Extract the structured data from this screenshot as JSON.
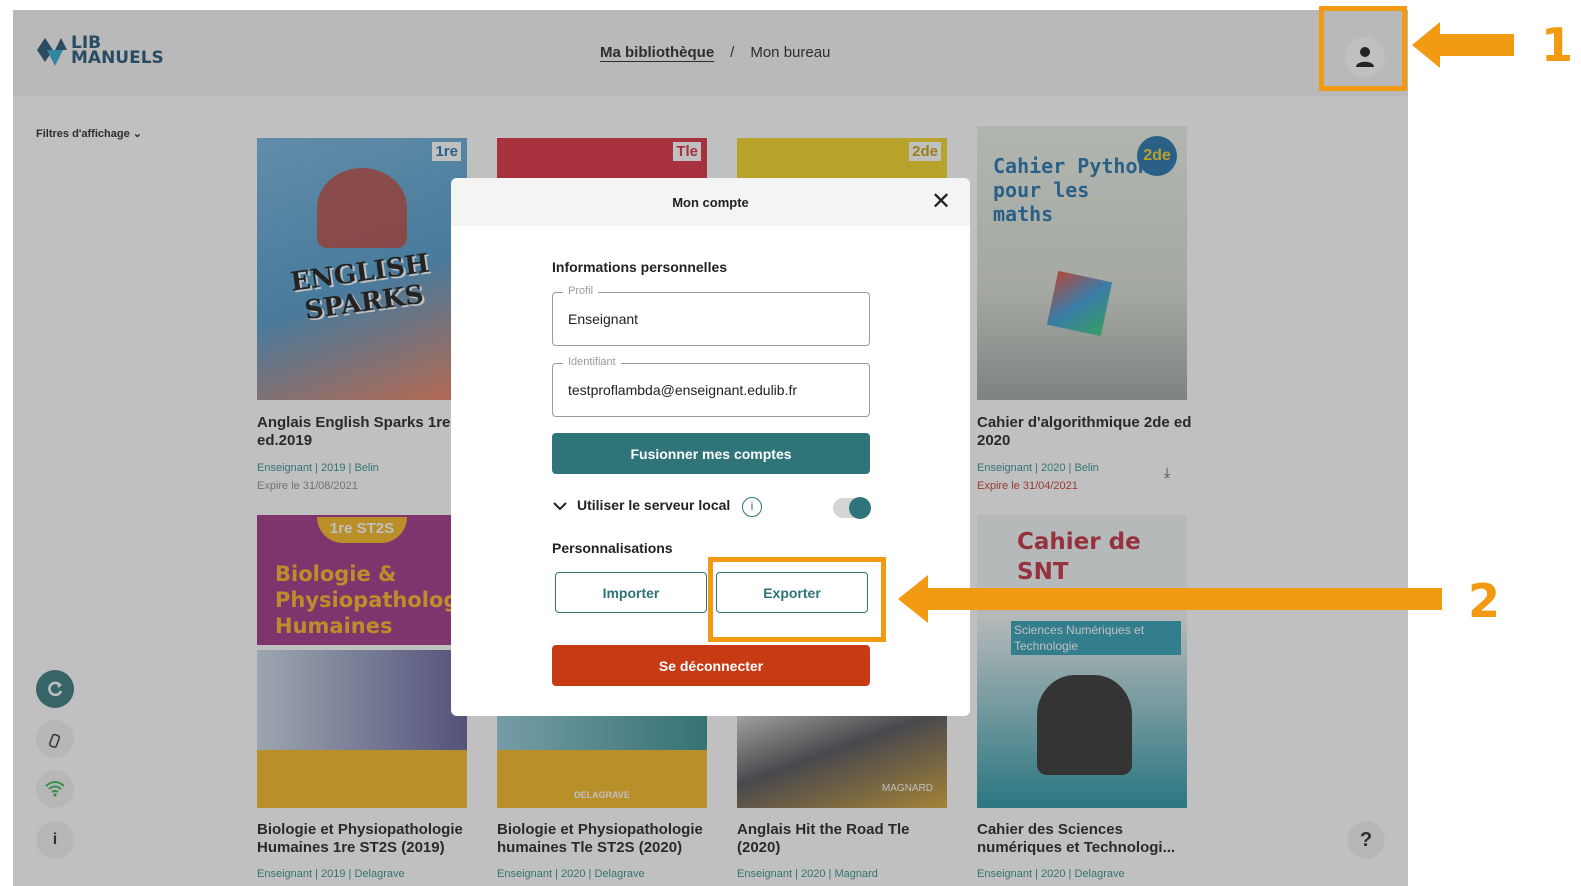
{
  "app": {
    "logo": {
      "line1": "LIB",
      "line2": "MANUELS"
    },
    "breadcrumb": {
      "current": "Ma bibliothèque",
      "separator": "/",
      "next": "Mon bureau"
    }
  },
  "filters": {
    "label": "Filtres d'affichage",
    "chevron": "⌄"
  },
  "books": [
    {
      "title": "Anglais English Sparks 1re ed.2019",
      "meta": "Enseignant | 2019 | Belin",
      "expiry": "Expire le 31/08/2021",
      "cover_text": "ENGLISH SPARKS",
      "badge": "1re"
    },
    {
      "title": "",
      "meta": "",
      "expiry": "",
      "cover_text": "",
      "badge": "Tle"
    },
    {
      "title": "",
      "meta": "",
      "expiry": "",
      "cover_text": "",
      "badge": "2de"
    },
    {
      "title": "Cahier d'algorithmique 2de ed 2020",
      "meta": "Enseignant | 2020 | Belin",
      "expiry": "Expire le 31/04/2021",
      "cover_text": "Cahier Python pour les maths",
      "badge": "2de"
    },
    {
      "title": "Biologie et Physiopathologie Humaines 1re ST2S (2019)",
      "meta": "Enseignant | 2019 | Delagrave",
      "cover_text": "Biologie & Physiopathologie Humaines",
      "badge": "1re ST2S"
    },
    {
      "title": "Biologie et Physiopathologie humaines Tle ST2S (2020)",
      "meta": "Enseignant | 2020 | Delagrave",
      "cover_text": "DELAGRAVE"
    },
    {
      "title": "Anglais Hit the Road Tle (2020)",
      "meta": "Enseignant | 2020 | Magnard",
      "cover_text": "MAGNARD"
    },
    {
      "title": "Cahier des Sciences numériques et Technologi...",
      "meta": "Enseignant | 2020 | Delagrave",
      "cover_text": "Cahier de SNT",
      "subtitle": "Sciences Numériques et Technologie"
    }
  ],
  "sidebar": {
    "sync_icon": "sync-icon",
    "usb_icon": "usb-icon",
    "wifi_icon": "wifi-icon",
    "info_label": "i"
  },
  "help": {
    "label": "?"
  },
  "modal": {
    "title": "Mon compte",
    "close_label": "✕",
    "personal_section": "Informations personnelles",
    "profile": {
      "label": "Profil",
      "value": "Enseignant"
    },
    "identifier": {
      "label": "Identifiant",
      "value": "testproflambda@enseignant.edulib.fr"
    },
    "merge_button": "Fusionner mes comptes",
    "local_server": {
      "label": "Utiliser le serveur local",
      "info": "i",
      "enabled": true
    },
    "custom_section": "Personnalisations",
    "import_button": "Importer",
    "export_button": "Exporter",
    "logout_button": "Se déconnecter"
  },
  "annotations": {
    "step1": "1",
    "step2": "2",
    "color": "#f29a11"
  },
  "colors": {
    "teal": "#2e7479",
    "logout": "#c83a14",
    "logo": "#1c4f73"
  }
}
